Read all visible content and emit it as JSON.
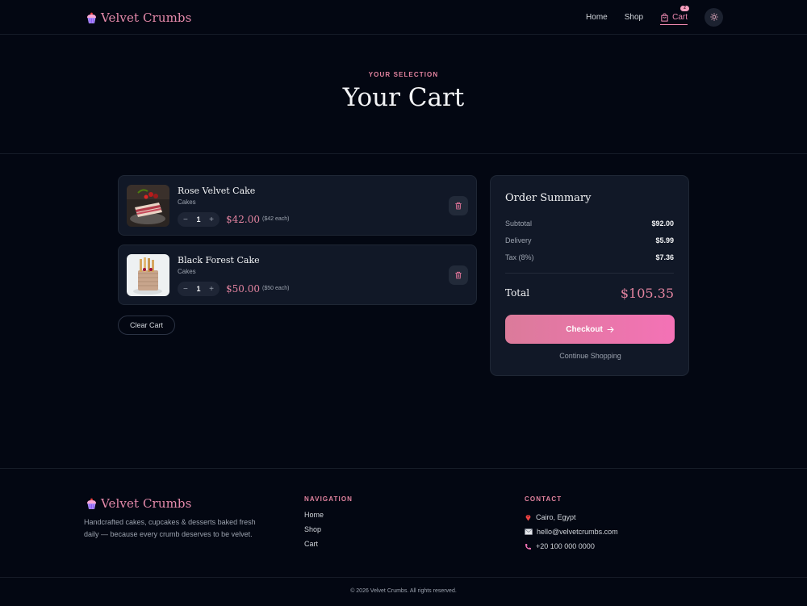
{
  "brand": {
    "name": "Velvet Crumbs",
    "accent": "#e58aab"
  },
  "nav": {
    "home": "Home",
    "shop": "Shop",
    "cart": "Cart",
    "cart_count": "2"
  },
  "hero": {
    "eyebrow": "YOUR SELECTION",
    "title": "Your Cart"
  },
  "cart": {
    "items": [
      {
        "name": "Rose Velvet Cake",
        "category": "Cakes",
        "qty": "1",
        "minus": "−",
        "plus": "+",
        "price": "$42.00",
        "each": "($42 each)"
      },
      {
        "name": "Black Forest Cake",
        "category": "Cakes",
        "qty": "1",
        "minus": "−",
        "plus": "+",
        "price": "$50.00",
        "each": "($50 each)"
      }
    ],
    "clear_label": "Clear Cart"
  },
  "summary": {
    "title": "Order Summary",
    "subtotal_label": "Subtotal",
    "subtotal": "$92.00",
    "delivery_label": "Delivery",
    "delivery": "$5.99",
    "tax_label": "Tax (8%)",
    "tax": "$7.36",
    "total_label": "Total",
    "total": "$105.35",
    "checkout_label": "Checkout",
    "continue_label": "Continue Shopping"
  },
  "footer": {
    "brand": "Velvet Crumbs",
    "description": "Handcrafted cakes, cupcakes & desserts baked fresh daily — because every crumb deserves to be velvet.",
    "nav_heading": "NAVIGATION",
    "nav_links": [
      "Home",
      "Shop",
      "Cart"
    ],
    "contact_heading": "CONTACT",
    "location": "Cairo, Egypt",
    "email": "hello@velvetcrumbs.com",
    "phone": "+20 100 000 0000",
    "copyright": "© 2026 Velvet Crumbs. All rights reserved."
  }
}
